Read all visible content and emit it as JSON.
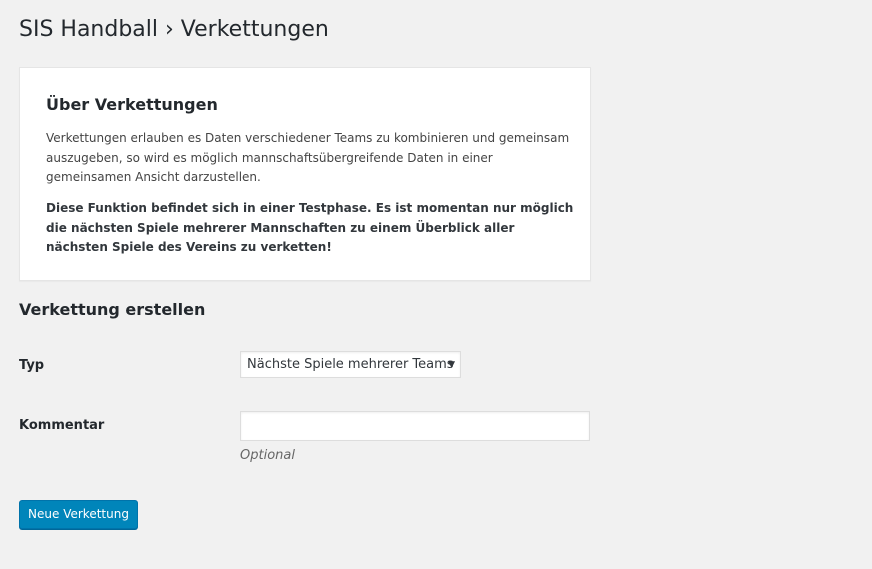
{
  "page": {
    "title": "SIS Handball › Verkettungen"
  },
  "info_card": {
    "heading": "Über Verkettungen",
    "intro": "Verkettungen erlauben es Daten verschiedener Teams zu kombinieren und gemeinsam auszugeben, so wird es möglich mannschaftsübergreifende Daten in einer gemeinsamen Ansicht darzustellen.",
    "warning": "Diese Funktion befindet sich in einer Testphase. Es ist momentan nur möglich die nächsten Spiele mehrerer Mannschaften zu einem Überblick aller nächsten Spiele des Vereins zu verketten!"
  },
  "form": {
    "section_title": "Verkettung erstellen",
    "type_label": "Typ",
    "type_selected": "Nächste Spiele mehrerer Teams",
    "type_arrow_icon": "caret-down-icon",
    "comment_label": "Kommentar",
    "comment_value": "",
    "comment_help": "Optional",
    "submit_label": "Neue Verkettung"
  },
  "colors": {
    "background": "#f1f1f1",
    "card": "#ffffff",
    "primary": "#0085ba",
    "text": "#23282d"
  }
}
